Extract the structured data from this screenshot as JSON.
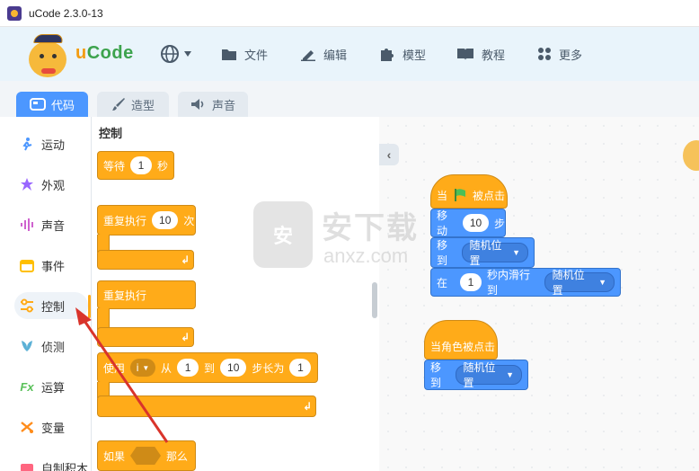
{
  "window": {
    "title": "uCode 2.3.0-13"
  },
  "brand": {
    "prefix": "u",
    "name": "Code"
  },
  "menu": {
    "globe_icon": "globe-icon",
    "items": [
      {
        "label": "文件",
        "icon": "folder-icon"
      },
      {
        "label": "编辑",
        "icon": "pencil-icon"
      },
      {
        "label": "模型",
        "icon": "puzzle-icon"
      },
      {
        "label": "教程",
        "icon": "book-icon"
      },
      {
        "label": "更多",
        "icon": "grid-icon"
      }
    ]
  },
  "tabs": [
    {
      "label": "代码",
      "active": true,
      "icon": "code-icon"
    },
    {
      "label": "造型",
      "active": false,
      "icon": "brush-icon"
    },
    {
      "label": "声音",
      "active": false,
      "icon": "speaker-icon"
    }
  ],
  "categories": [
    {
      "label": "运动",
      "icon": "motion-icon",
      "color": "#4c97ff"
    },
    {
      "label": "外观",
      "icon": "looks-icon",
      "color": "#9966ff"
    },
    {
      "label": "声音",
      "icon": "sound-icon",
      "color": "#cf63cf"
    },
    {
      "label": "事件",
      "icon": "event-icon",
      "color": "#ffbf00"
    },
    {
      "label": "控制",
      "icon": "control-icon",
      "color": "#ffab19",
      "active": true
    },
    {
      "label": "侦测",
      "icon": "sensing-icon",
      "color": "#5cb1d6"
    },
    {
      "label": "运算",
      "icon": "operator-icon",
      "color": "#59c059"
    },
    {
      "label": "变量",
      "icon": "variable-icon",
      "color": "#ff8c1a"
    },
    {
      "label": "自制积木",
      "icon": "myblocks-icon",
      "color": "#ff6680"
    }
  ],
  "palette": {
    "title": "控制",
    "wait": {
      "label": "等待",
      "value": "1",
      "unit": "秒"
    },
    "repeat": {
      "label": "重复执行",
      "value": "10",
      "unit": "次"
    },
    "forever": {
      "label": "重复执行"
    },
    "for_loop": {
      "label": "使用",
      "var": "i",
      "from": "从",
      "start": "1",
      "to": "到",
      "end": "10",
      "step_label": "步长为",
      "step": "1"
    },
    "if": {
      "label": "如果",
      "then": "那么"
    }
  },
  "script": {
    "stack1": {
      "hat_prefix": "当",
      "hat_suffix": "被点击",
      "move": {
        "label": "移动",
        "value": "10",
        "unit": "步"
      },
      "goto": {
        "label": "移到",
        "option": "随机位置"
      },
      "glide": {
        "label": "在",
        "value": "1",
        "middle": "秒内滑行到",
        "option": "随机位置"
      }
    },
    "stack2": {
      "hat": "当角色被点击",
      "goto": {
        "label": "移到",
        "option": "随机位置"
      }
    }
  },
  "watermark": {
    "cn": "安下载",
    "en": "anxz.com",
    "badge": "安"
  },
  "colors": {
    "control": "#ffab19",
    "motion": "#4c97ff",
    "accent": "#4c97ff",
    "annotation": "#d9342b"
  }
}
